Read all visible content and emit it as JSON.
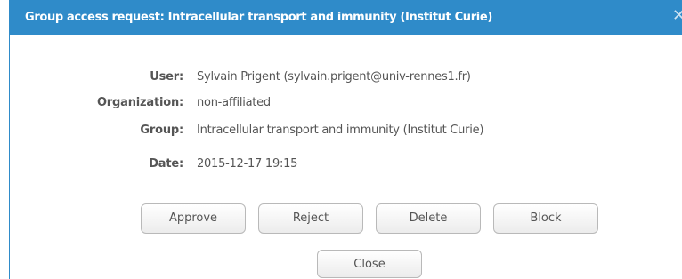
{
  "dialog": {
    "title": "Group access request: Intracellular transport and immunity (Institut Curie)",
    "close_glyph": "✕"
  },
  "details": {
    "user_label": "User:",
    "user_value": "Sylvain Prigent (sylvain.prigent@univ-rennes1.fr)",
    "organization_label": "Organization:",
    "organization_value": "non-affiliated",
    "group_label": "Group:",
    "group_value": "Intracellular transport and immunity (Institut Curie)",
    "date_label": "Date:",
    "date_value": "2015-12-17 19:15"
  },
  "actions": {
    "approve": "Approve",
    "reject": "Reject",
    "delete": "Delete",
    "block": "Block",
    "close": "Close"
  },
  "colors": {
    "titlebar": "#2f8bc9",
    "title_text": "#ffffff",
    "body_text": "#555555"
  },
  "icons": {
    "close": "close-icon"
  }
}
